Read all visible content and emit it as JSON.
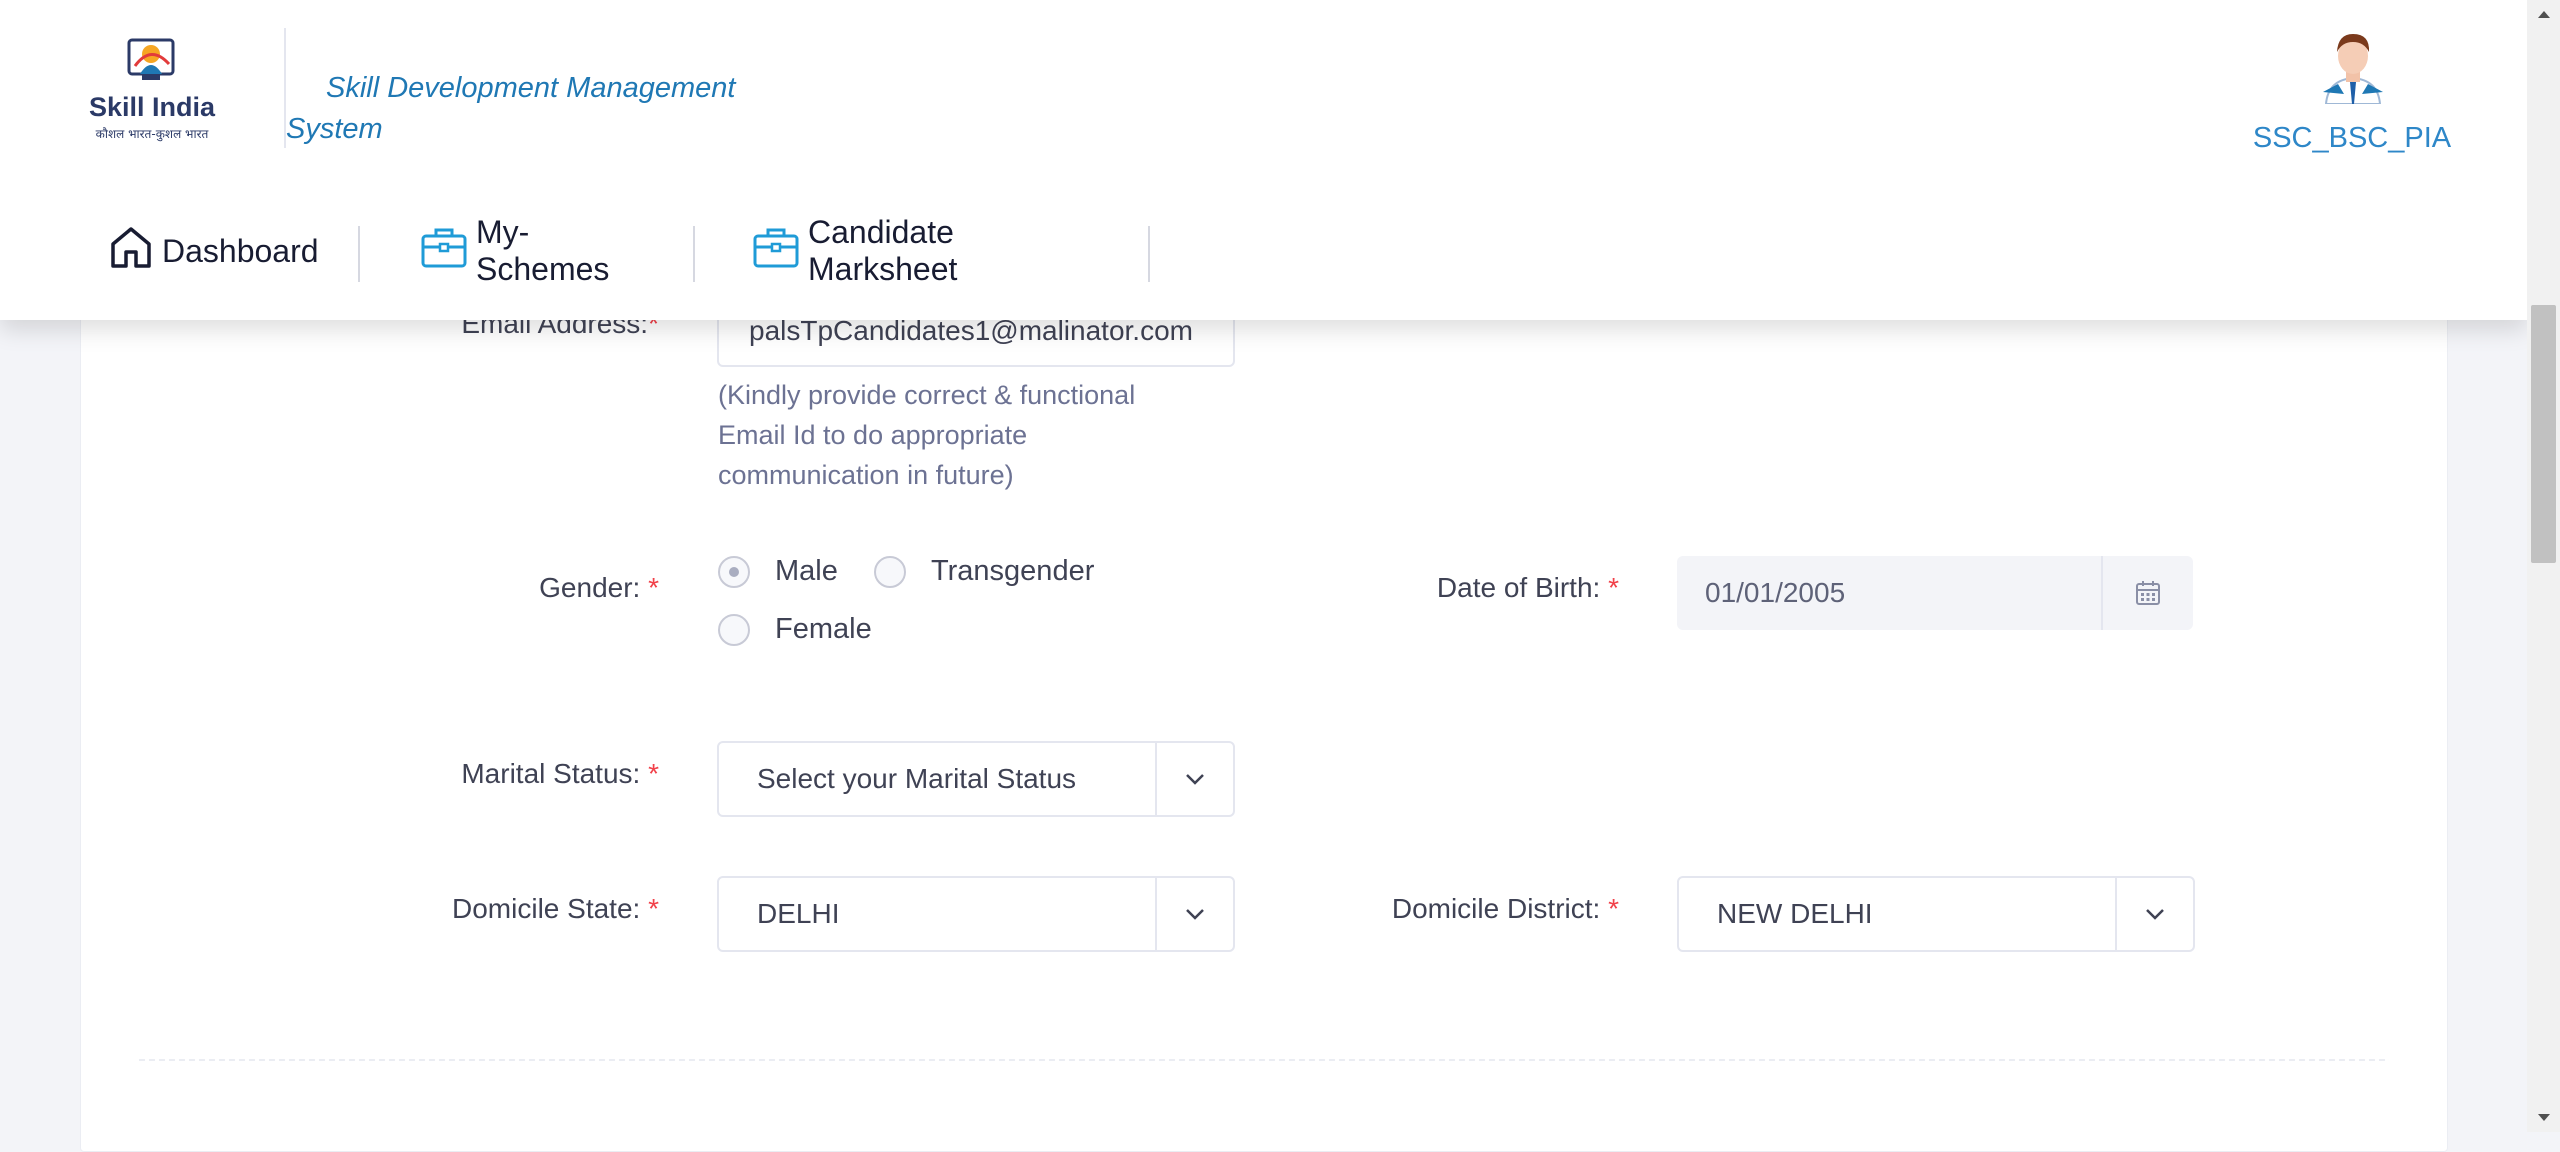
{
  "header": {
    "logo": {
      "title": "Skill India",
      "tagline": "कौशल भारत-कुशल भारत"
    },
    "app_title_line1": "Skill Development Management",
    "app_title_line2": "System",
    "user_name": "SSC_BSC_PIA",
    "avatar_icon": "user-avatar-icon"
  },
  "nav": {
    "items": [
      {
        "label": "Dashboard",
        "icon": "home-icon"
      },
      {
        "label": "My-Schemes",
        "icon": "briefcase-icon"
      },
      {
        "label": "Candidate Marksheet",
        "icon": "briefcase-icon"
      }
    ]
  },
  "form": {
    "email": {
      "label": "Email Address:",
      "required": "*",
      "value": "palsTpCandidates1@malinator.com",
      "help_line1": "(Kindly provide correct & functional",
      "help_line2": "Email Id to do appropriate",
      "help_line3": "communication in future)"
    },
    "gender": {
      "label": "Gender:",
      "required": "*",
      "options": [
        "Male",
        "Transgender",
        "Female"
      ],
      "selected": "Male"
    },
    "dob": {
      "label": "Date of Birth:",
      "required": "*",
      "value": "01/01/2005",
      "icon": "calendar-icon"
    },
    "marital_status": {
      "label": "Marital Status:",
      "required": "*",
      "value": "Select your Marital Status"
    },
    "domicile_state": {
      "label": "Domicile State:",
      "required": "*",
      "value": "DELHI"
    },
    "domicile_district": {
      "label": "Domicile District:",
      "required": "*",
      "value": "NEW DELHI"
    }
  },
  "colors": {
    "accent": "#1f78b4",
    "required": "#f1414a",
    "page_bg": "#f3f4f8"
  }
}
